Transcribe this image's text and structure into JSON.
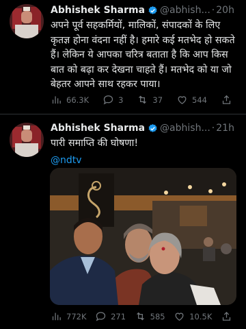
{
  "tweets": [
    {
      "author_name": "Abhishek Sharma",
      "handle": "@abhish...",
      "separator": "·",
      "time": "20h",
      "text": "अपने पूर्व सहकर्मियों, मालिकों, संपादकों के लिए कृतज्ञ होना वंदना नहीं है। हमारे कई मतभेद हो सकते हैं। लेकिन ये आपका चरित्र बताता है कि आप किस बात को बढ़ा कर देखना चाहते हैं। मतभेद को या जो बेहतर आपने साथ रहकर पाया।",
      "stats": {
        "views": "66.3K",
        "replies": "3",
        "retweets": "37",
        "likes": "544"
      }
    },
    {
      "author_name": "Abhishek Sharma",
      "handle": "@abhish...",
      "separator": "·",
      "time": "21h",
      "text": "पारी समाप्ति की घोषणा!",
      "mention": "@ndtv",
      "stats": {
        "views": "772K",
        "replies": "271",
        "retweets": "585",
        "likes": "10.5K"
      }
    }
  ],
  "colors": {
    "background": "#000000",
    "text": "#e7e9ea",
    "secondary": "#71767b",
    "accent": "#1d9bf0",
    "divider": "#2f3336"
  },
  "icons": [
    "verified-badge-icon",
    "views-icon",
    "reply-icon",
    "retweet-icon",
    "like-icon",
    "share-icon"
  ]
}
